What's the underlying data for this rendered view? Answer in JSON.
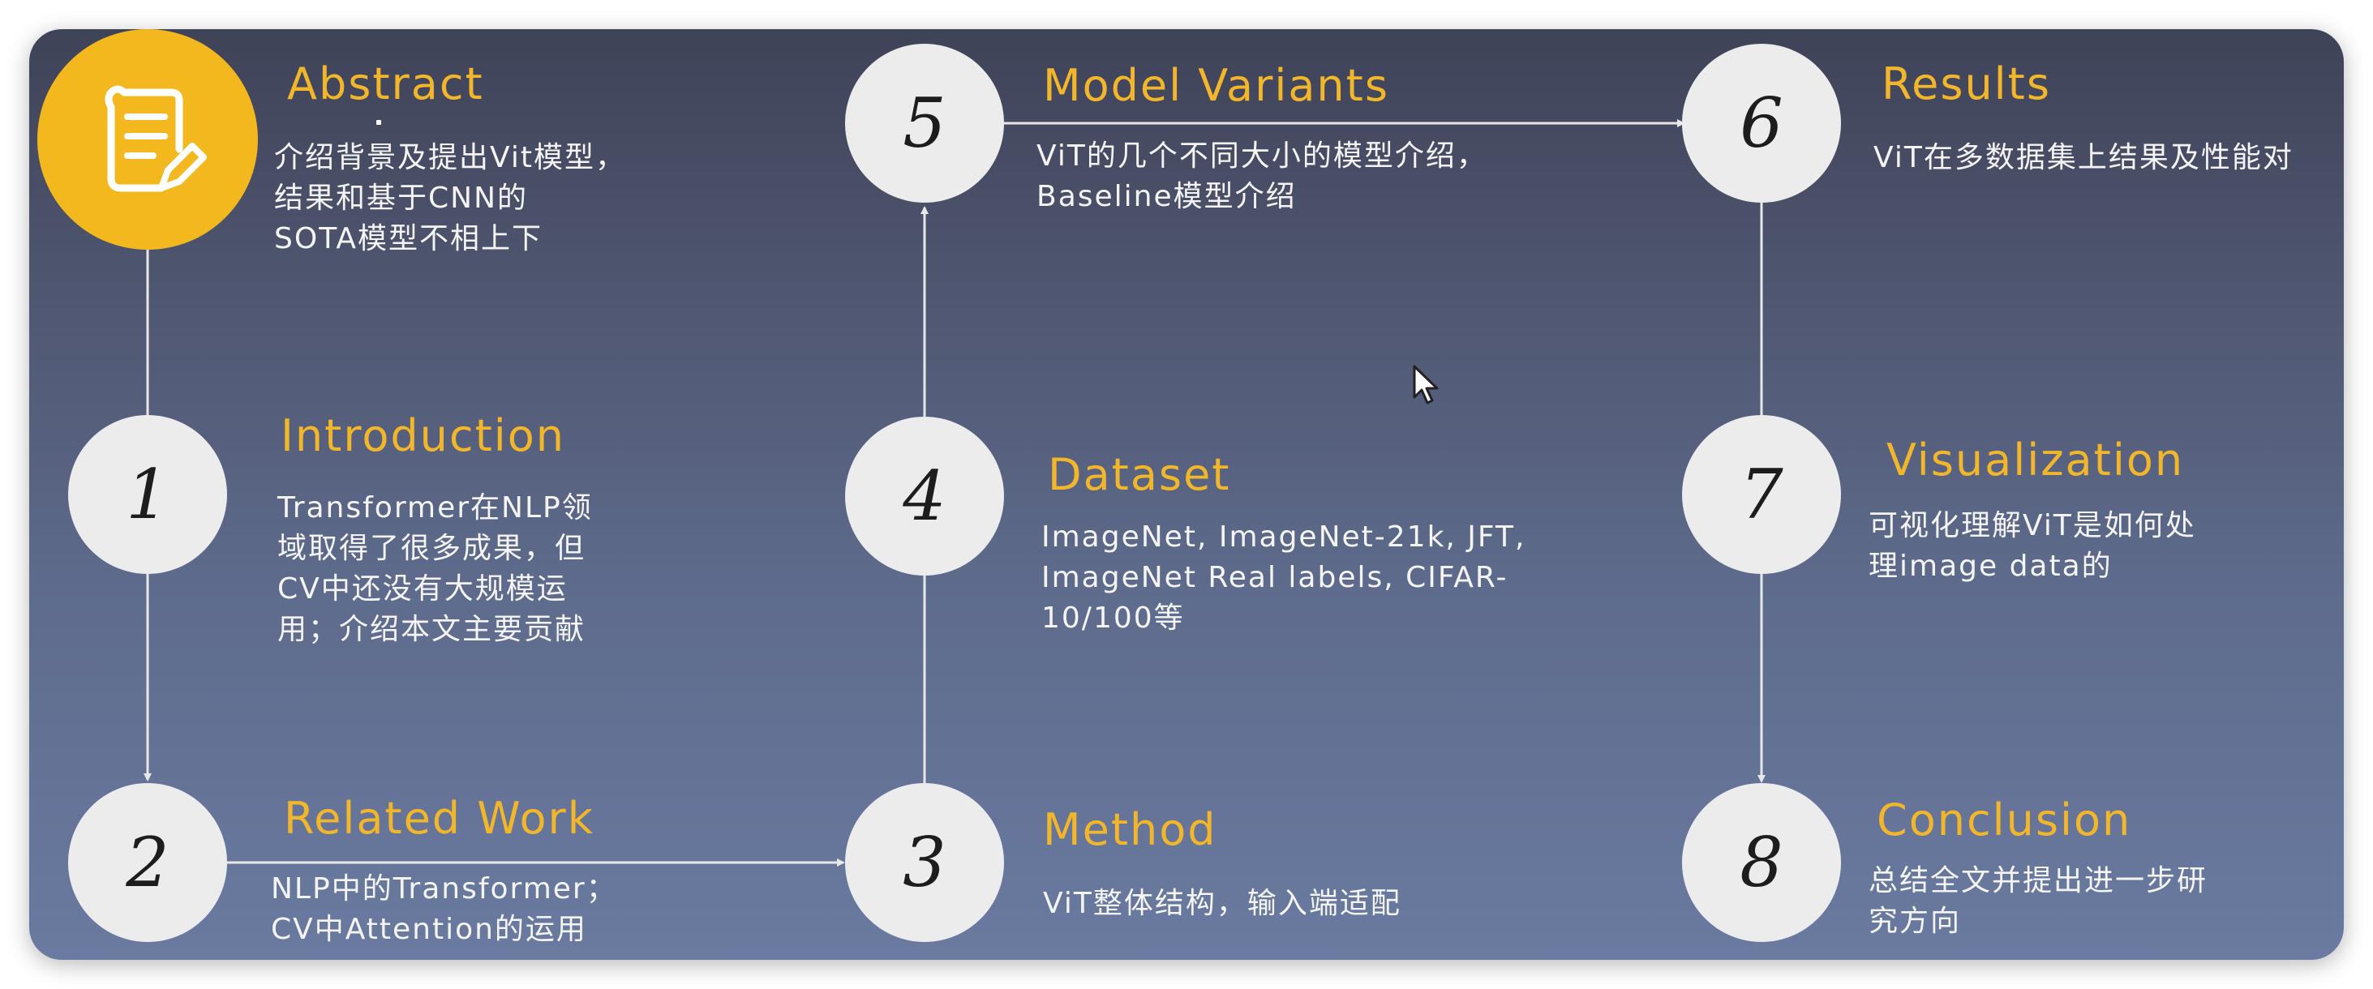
{
  "sections": [
    {
      "id": "abstract",
      "number": "",
      "title": "Abstract",
      "desc": "介绍背景及提出Vit模型，\n结果和基于CNN的\nSOTA模型不相上下"
    },
    {
      "id": "1",
      "number": "1",
      "title": "Introduction",
      "desc": "Transformer在NLP领\n域取得了很多成果，但\nCV中还没有大规模运\n用；介绍本文主要贡献"
    },
    {
      "id": "2",
      "number": "2",
      "title": "Related Work",
      "desc": "NLP中的Transformer；\nCV中Attention的运用"
    },
    {
      "id": "3",
      "number": "3",
      "title": "Method",
      "desc": "ViT整体结构，输入端适配"
    },
    {
      "id": "4",
      "number": "4",
      "title": "Dataset",
      "desc": "ImageNet, ImageNet-21k, JFT,\nImageNet Real labels, CIFAR-\n10/100等"
    },
    {
      "id": "5",
      "number": "5",
      "title": "Model Variants",
      "desc": "ViT的几个不同大小的模型介绍，\nBaseline模型介绍"
    },
    {
      "id": "6",
      "number": "6",
      "title": "Results",
      "desc": "ViT在多数据集上结果及性能对"
    },
    {
      "id": "7",
      "number": "7",
      "title": "Visualization",
      "desc": "可视化理解ViT是如何处\n理image data的"
    },
    {
      "id": "8",
      "number": "8",
      "title": "Conclusion",
      "desc": "总结全文并提出进一步研\n究方向"
    }
  ],
  "icons": {
    "abstract": "document-pencil-icon",
    "cursor": "mouse-cursor-icon"
  },
  "colors": {
    "accent": "#f2b62a",
    "node": "#ececec",
    "text": "#f4f4f4",
    "connector": "#e8e8e8"
  }
}
